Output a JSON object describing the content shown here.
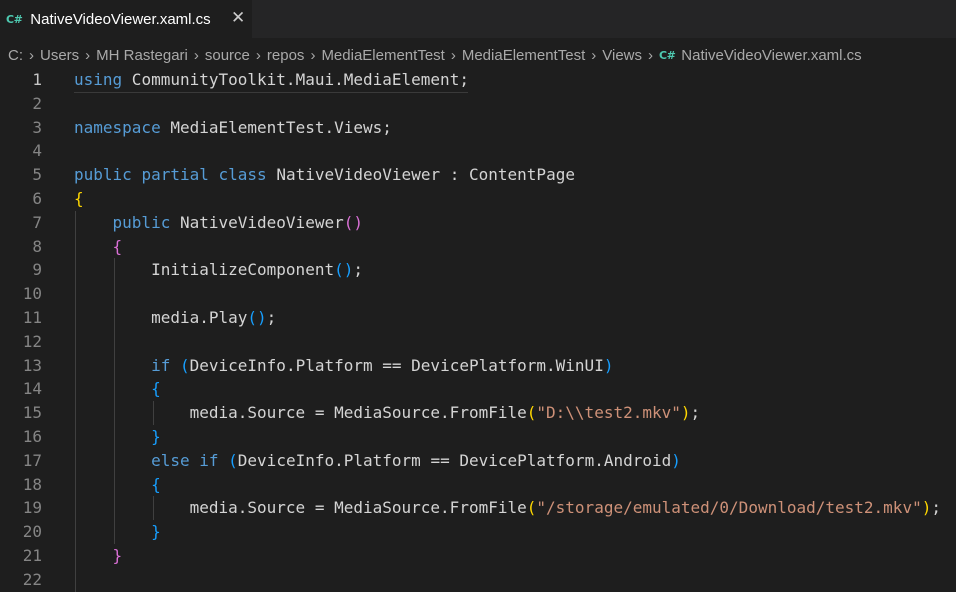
{
  "tab": {
    "icon": "C#",
    "title": "NativeVideoViewer.xaml.cs",
    "close": "✕"
  },
  "breadcrumb": [
    "C:",
    "Users",
    "MH Rastegari",
    "source",
    "repos",
    "MediaElementTest",
    "MediaElementTest",
    "Views"
  ],
  "breadcrumb_file": {
    "icon": "C#",
    "name": "NativeVideoViewer.xaml.cs"
  },
  "lines": [
    {
      "n": "1",
      "parts": [
        [
          "k",
          "using"
        ],
        [
          "p",
          " CommunityToolkit.Maui.MediaElement;"
        ]
      ]
    },
    {
      "n": "2",
      "parts": []
    },
    {
      "n": "3",
      "parts": [
        [
          "k",
          "namespace"
        ],
        [
          "p",
          " MediaElementTest.Views;"
        ]
      ]
    },
    {
      "n": "4",
      "parts": []
    },
    {
      "n": "5",
      "parts": [
        [
          "k",
          "public"
        ],
        [
          "p",
          " "
        ],
        [
          "k",
          "partial"
        ],
        [
          "p",
          " "
        ],
        [
          "k",
          "class"
        ],
        [
          "p",
          " "
        ],
        [
          "p",
          "NativeVideoViewer"
        ],
        [
          "p",
          " : "
        ],
        [
          "p",
          "ContentPage"
        ]
      ]
    },
    {
      "n": "6",
      "parts": [
        [
          "y",
          "{"
        ]
      ]
    },
    {
      "n": "7",
      "parts": [
        [
          "p",
          "    "
        ],
        [
          "k",
          "public"
        ],
        [
          "p",
          " NativeVideoViewer"
        ],
        [
          "m",
          "()"
        ]
      ]
    },
    {
      "n": "8",
      "parts": [
        [
          "p",
          "    "
        ],
        [
          "m",
          "{"
        ]
      ]
    },
    {
      "n": "9",
      "parts": [
        [
          "p",
          "        InitializeComponent"
        ],
        [
          "b",
          "()"
        ],
        [
          "p",
          ";"
        ]
      ]
    },
    {
      "n": "10",
      "parts": []
    },
    {
      "n": "11",
      "parts": [
        [
          "p",
          "        media.Play"
        ],
        [
          "b",
          "()"
        ],
        [
          "p",
          ";"
        ]
      ]
    },
    {
      "n": "12",
      "parts": []
    },
    {
      "n": "13",
      "parts": [
        [
          "p",
          "        "
        ],
        [
          "k",
          "if"
        ],
        [
          "p",
          " "
        ],
        [
          "b",
          "("
        ],
        [
          "p",
          "DeviceInfo.Platform == DevicePlatform.WinUI"
        ],
        [
          "b",
          ")"
        ]
      ]
    },
    {
      "n": "14",
      "parts": [
        [
          "p",
          "        "
        ],
        [
          "b",
          "{"
        ]
      ]
    },
    {
      "n": "15",
      "parts": [
        [
          "p",
          "            media.Source = MediaSource.FromFile"
        ],
        [
          "y",
          "("
        ],
        [
          "s",
          "\"D:\\\\test2.mkv\""
        ],
        [
          "y",
          ")"
        ],
        [
          "p",
          ";"
        ]
      ]
    },
    {
      "n": "16",
      "parts": [
        [
          "p",
          "        "
        ],
        [
          "b",
          "}"
        ]
      ]
    },
    {
      "n": "17",
      "parts": [
        [
          "p",
          "        "
        ],
        [
          "k",
          "else"
        ],
        [
          "p",
          " "
        ],
        [
          "k",
          "if"
        ],
        [
          "p",
          " "
        ],
        [
          "b",
          "("
        ],
        [
          "p",
          "DeviceInfo.Platform == DevicePlatform.Android"
        ],
        [
          "b",
          ")"
        ]
      ]
    },
    {
      "n": "18",
      "parts": [
        [
          "p",
          "        "
        ],
        [
          "b",
          "{"
        ]
      ]
    },
    {
      "n": "19",
      "parts": [
        [
          "p",
          "            media.Source = MediaSource.FromFile"
        ],
        [
          "y",
          "("
        ],
        [
          "s",
          "\"/storage/emulated/0/Download/test2.mkv\""
        ],
        [
          "y",
          ")"
        ],
        [
          "p",
          ";"
        ]
      ]
    },
    {
      "n": "20",
      "parts": [
        [
          "p",
          "        "
        ],
        [
          "b",
          "}"
        ]
      ]
    },
    {
      "n": "21",
      "parts": [
        [
          "p",
          "    "
        ],
        [
          "m",
          "}"
        ]
      ]
    },
    {
      "n": "22",
      "parts": []
    }
  ],
  "active_line": "1"
}
